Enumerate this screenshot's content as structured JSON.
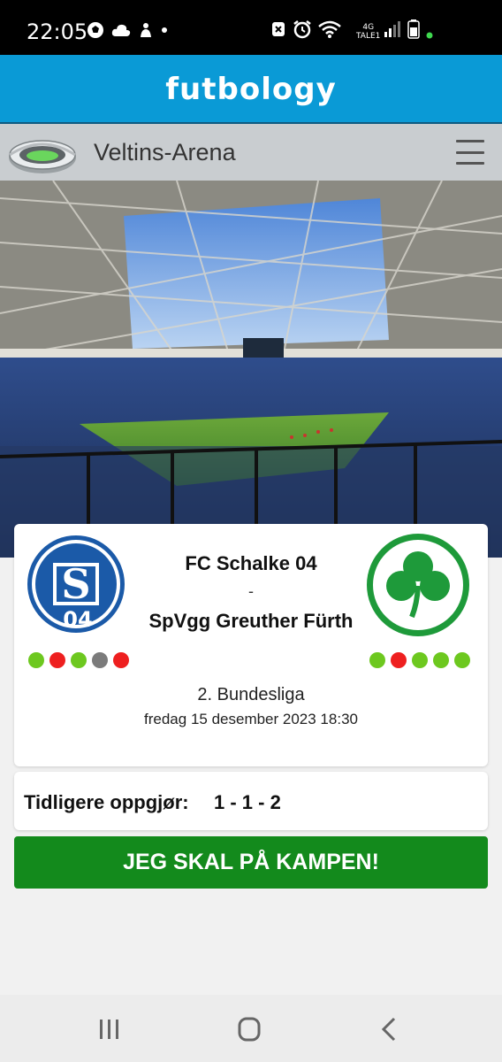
{
  "status_bar": {
    "time": "22:05",
    "network_type": "4G",
    "carrier": "TALE1",
    "icons_left": [
      "soccer-ball-icon",
      "cloud-icon",
      "app-notification-icon",
      "dot-icon"
    ],
    "icons_right": [
      "nfc-icon",
      "alarm-icon",
      "wifi-icon",
      "signal-icon",
      "battery-icon"
    ]
  },
  "header": {
    "brand": "futbology"
  },
  "venue": {
    "name": "Veltins-Arena"
  },
  "match": {
    "home_team": "FC Schalke 04",
    "separator": "-",
    "away_team": "SpVgg Greuther Fürth",
    "competition": "2. Bundesliga",
    "datetime": "fredag 15 desember 2023 18:30",
    "home_form": [
      "win",
      "loss",
      "win",
      "draw",
      "loss"
    ],
    "away_form": [
      "win",
      "loss",
      "win",
      "win",
      "win"
    ],
    "colors": {
      "win": "#6dc81f",
      "loss": "#ee1f1f",
      "draw": "#7b7b7b"
    }
  },
  "history": {
    "label": "Tidligere oppgjør:",
    "score": "1 - 1 - 2"
  },
  "cta": {
    "label": "JEG SKAL PÅ KAMPEN!"
  },
  "colors": {
    "brand_blue": "#0a9ad6",
    "cta_green": "#138a1c",
    "venue_bar": "#c9cdd0"
  }
}
